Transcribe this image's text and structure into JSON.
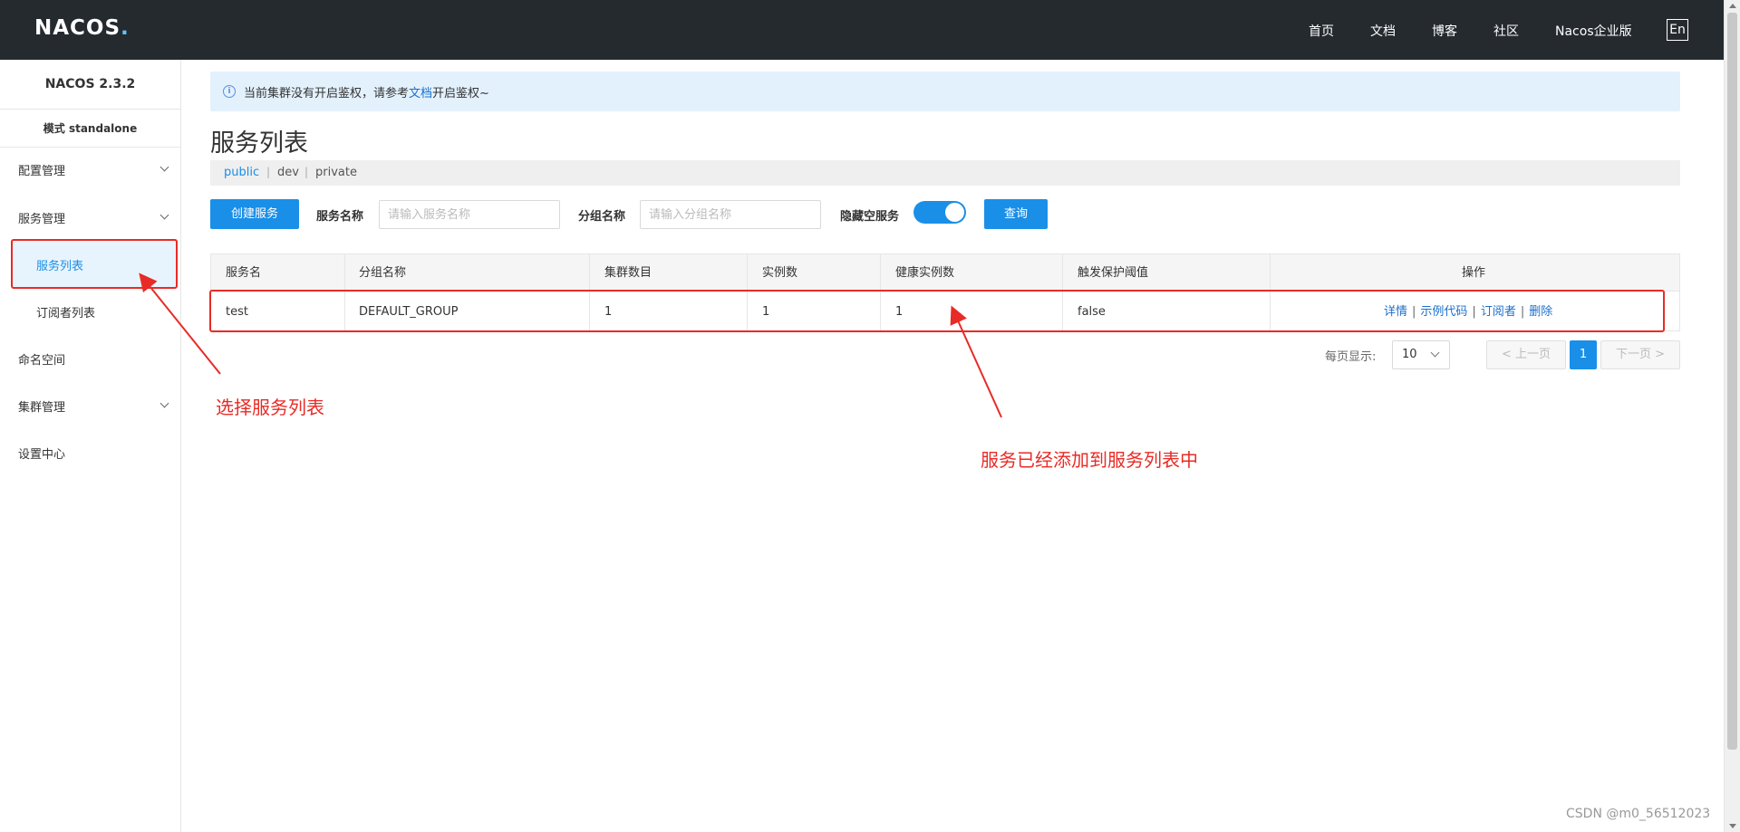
{
  "header": {
    "logo": "NACOS",
    "logo_dot": ".",
    "nav": [
      "首页",
      "文档",
      "博客",
      "社区",
      "Nacos企业版"
    ],
    "lang": "En"
  },
  "sidebar": {
    "title": "NACOS 2.3.2",
    "mode": "模式 standalone",
    "items": [
      {
        "label": "配置管理"
      },
      {
        "label": "服务管理"
      },
      {
        "label": "服务列表"
      },
      {
        "label": "订阅者列表"
      },
      {
        "label": "命名空间"
      },
      {
        "label": "集群管理"
      },
      {
        "label": "设置中心"
      }
    ]
  },
  "notice": {
    "prefix": "当前集群没有开启鉴权，请参考",
    "link": "文档",
    "suffix": "开启鉴权~"
  },
  "page_title": "服务列表",
  "namespaces": [
    "public",
    "dev",
    "private"
  ],
  "namespace_sep": "|",
  "search": {
    "create_button": "创建服务",
    "service_name_label": "服务名称",
    "service_name_placeholder": "请输入服务名称",
    "group_name_label": "分组名称",
    "group_name_placeholder": "请输入分组名称",
    "hide_empty_label": "隐藏空服务",
    "hide_empty_on": true,
    "query_button": "查询"
  },
  "table": {
    "headers": [
      "服务名",
      "分组名称",
      "集群数目",
      "实例数",
      "健康实例数",
      "触发保护阈值",
      "操作"
    ],
    "rows": [
      {
        "cells": [
          "test",
          "DEFAULT_GROUP",
          "1",
          "1",
          "1",
          "false"
        ],
        "ops": [
          "详情",
          "示例代码",
          "订阅者",
          "删除"
        ]
      }
    ],
    "op_sep": "|"
  },
  "pagination": {
    "per_page_label": "每页显示:",
    "per_page": "10",
    "prev": "上一页",
    "prev_icon": "<",
    "current": "1",
    "next": "下一页",
    "next_icon": ">"
  },
  "annotations": {
    "left": "选择服务列表",
    "right": "服务已经添加到服务列表中",
    "color": "#e82b26"
  },
  "watermark": "CSDN @m0_56512023"
}
